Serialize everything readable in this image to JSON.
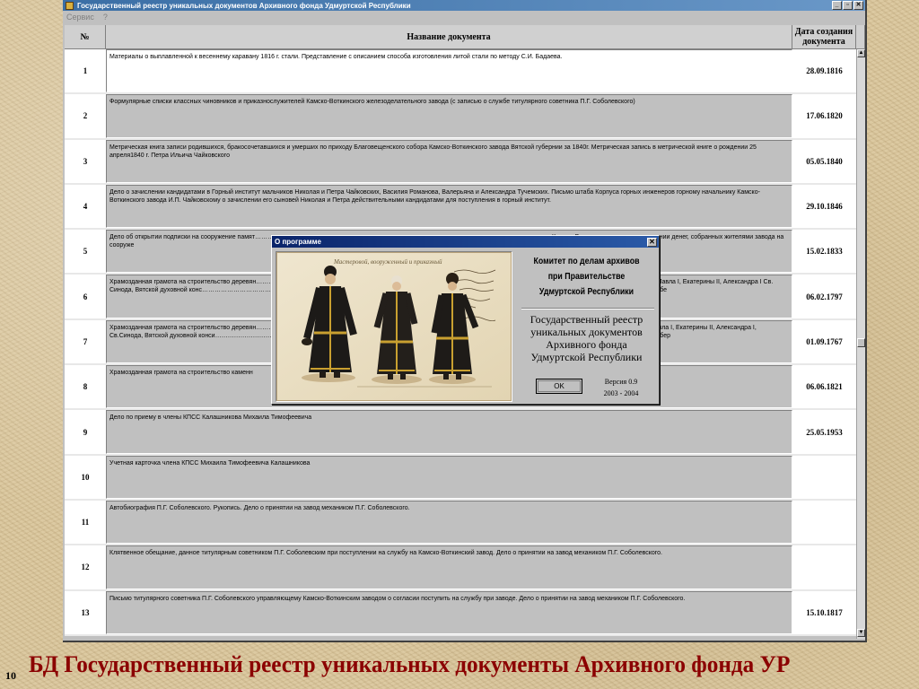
{
  "window": {
    "title": "Государственный реестр уникальных документов Архивного фонда Удмуртской Республики",
    "buttons": {
      "minimize": "_",
      "restore": "▫",
      "close": "✕"
    }
  },
  "menu": {
    "items": [
      "Сервис",
      "?"
    ]
  },
  "table": {
    "headers": {
      "num": "№",
      "title": "Название документа",
      "date": "Дата создания документа"
    },
    "rows": [
      {
        "num": "1",
        "title": "Материалы о выплавленной к весеннему каравану 1816 г. стали. Представление с описанием способа изготовления литой стали по методу С.И. Бадаева.",
        "date": "28.09.1816"
      },
      {
        "num": "2",
        "title": "Формулярные списки классных чиновников и приказнослужителей Камско-Воткинского железоделательного завода (с записью о службе титулярного советника П.Г. Соболевского)",
        "date": "17.06.1820"
      },
      {
        "num": "3",
        "title": "Метрическая книга записи родившихся, бракосочетавшихся и умерших по приходу Благовещенского собора Камско-Воткинского завода Вятской губернии за 1840г. Метрическая запись в метрической книге о рождении 25 апреля1840 г. Петра Ильича Чайковского",
        "date": "05.05.1840"
      },
      {
        "num": "4",
        "title": "Дело о зачислении кандидатами в Горный институт мальчиков Николая и Петра Чайковских, Василия Романова, Валерьяна и Александра Тучемских. Письмо штаба Корпуса горных инженеров горному начальнику Камско-Воткинского завода И.П. Чайковскому о зачислении его сыновей Николая и Петра действительными кандидатами для поступления в горный институт.",
        "date": "29.10.1846"
      },
      {
        "num": "5",
        "title": "Дело об открытии подписки на сооружение памят…………………………………………………………………………………………………………………………… Камско-Воткинского завода о получении денег, собранных жителями завода на сооруже",
        "date": "15.02.1833"
      },
      {
        "num": "6",
        "title": "Храмозданная грамота на строительство деревян……………………………………………………………………………………………………………………………………………… новны, Елизаветы I, Павла I, Екатерины II, Александра I Св. Синода, Вятской духовной конс……………………………………………………………………………………………………………………… вной церкви в с. Данилово Сарапульского уезда Вятской губе",
        "date": "06.02.1797"
      },
      {
        "num": "7",
        "title": "Храмозданная грамота на строительство деревян……………………………………………………………………………………………………………………………………………… вны, Елизаветы I, Павла I, Екатерины II, Александра I, Св.Синода, Вятской духовной конси…………………………………………………………………………………………………………………… ой церкви в с. Данилово Сарапульского уезда Вятской губер",
        "date": "01.09.1767"
      },
      {
        "num": "8",
        "title": "Храмозданная грамота на строительство каменн",
        "date": "06.06.1821"
      },
      {
        "num": "9",
        "title": "Дело по приему в члены КПСС Калашникова Михаила Тимофеевича",
        "date": "25.05.1953"
      },
      {
        "num": "10",
        "title": "Учетная карточка члена КПСС Михаила Тимофеевича Калашникова",
        "date": ""
      },
      {
        "num": "11",
        "title": "Автобиография П.Г. Соболевского. Рукопись. Дело о принятии на завод механиком П.Г. Соболевского.",
        "date": ""
      },
      {
        "num": "12",
        "title": "Клятвенное обещание, данное титулярным советником П.Г. Соболевским при поступлении на службу на Камско-Воткинский завод. Дело о принятии на завод механиком П.Г. Соболевского.",
        "date": ""
      },
      {
        "num": "13",
        "title": "Письмо титулярного советника П.Г. Соболевского управляющему Камско-Воткинским заводом о согласии поступить на службу при заводе. Дело о принятии на завод механиком П.Г. Соболевского.",
        "date": "15.10.1817"
      }
    ]
  },
  "about_dialog": {
    "title": "О программе",
    "close": "✕",
    "committee_lines": [
      "Комитет по делам архивов",
      "при Правительстве",
      "Удмуртской Республики"
    ],
    "registry_lines": [
      "Государственный реестр",
      "уникальных документов",
      "Архивного фонда",
      "Удмуртской Республики"
    ],
    "ok_label": "OK",
    "version": "Версия 0.9",
    "years": "2003 - 2004",
    "illustration_caption": "Мастеровой, вооруженный и приказный",
    "illustration_icon": "archival-illustration-three-figures"
  },
  "slide": {
    "number": "10",
    "caption": "БД Государственный реестр уникальных документы Архивного фонда УР",
    "caption_color": "#8b0000"
  }
}
